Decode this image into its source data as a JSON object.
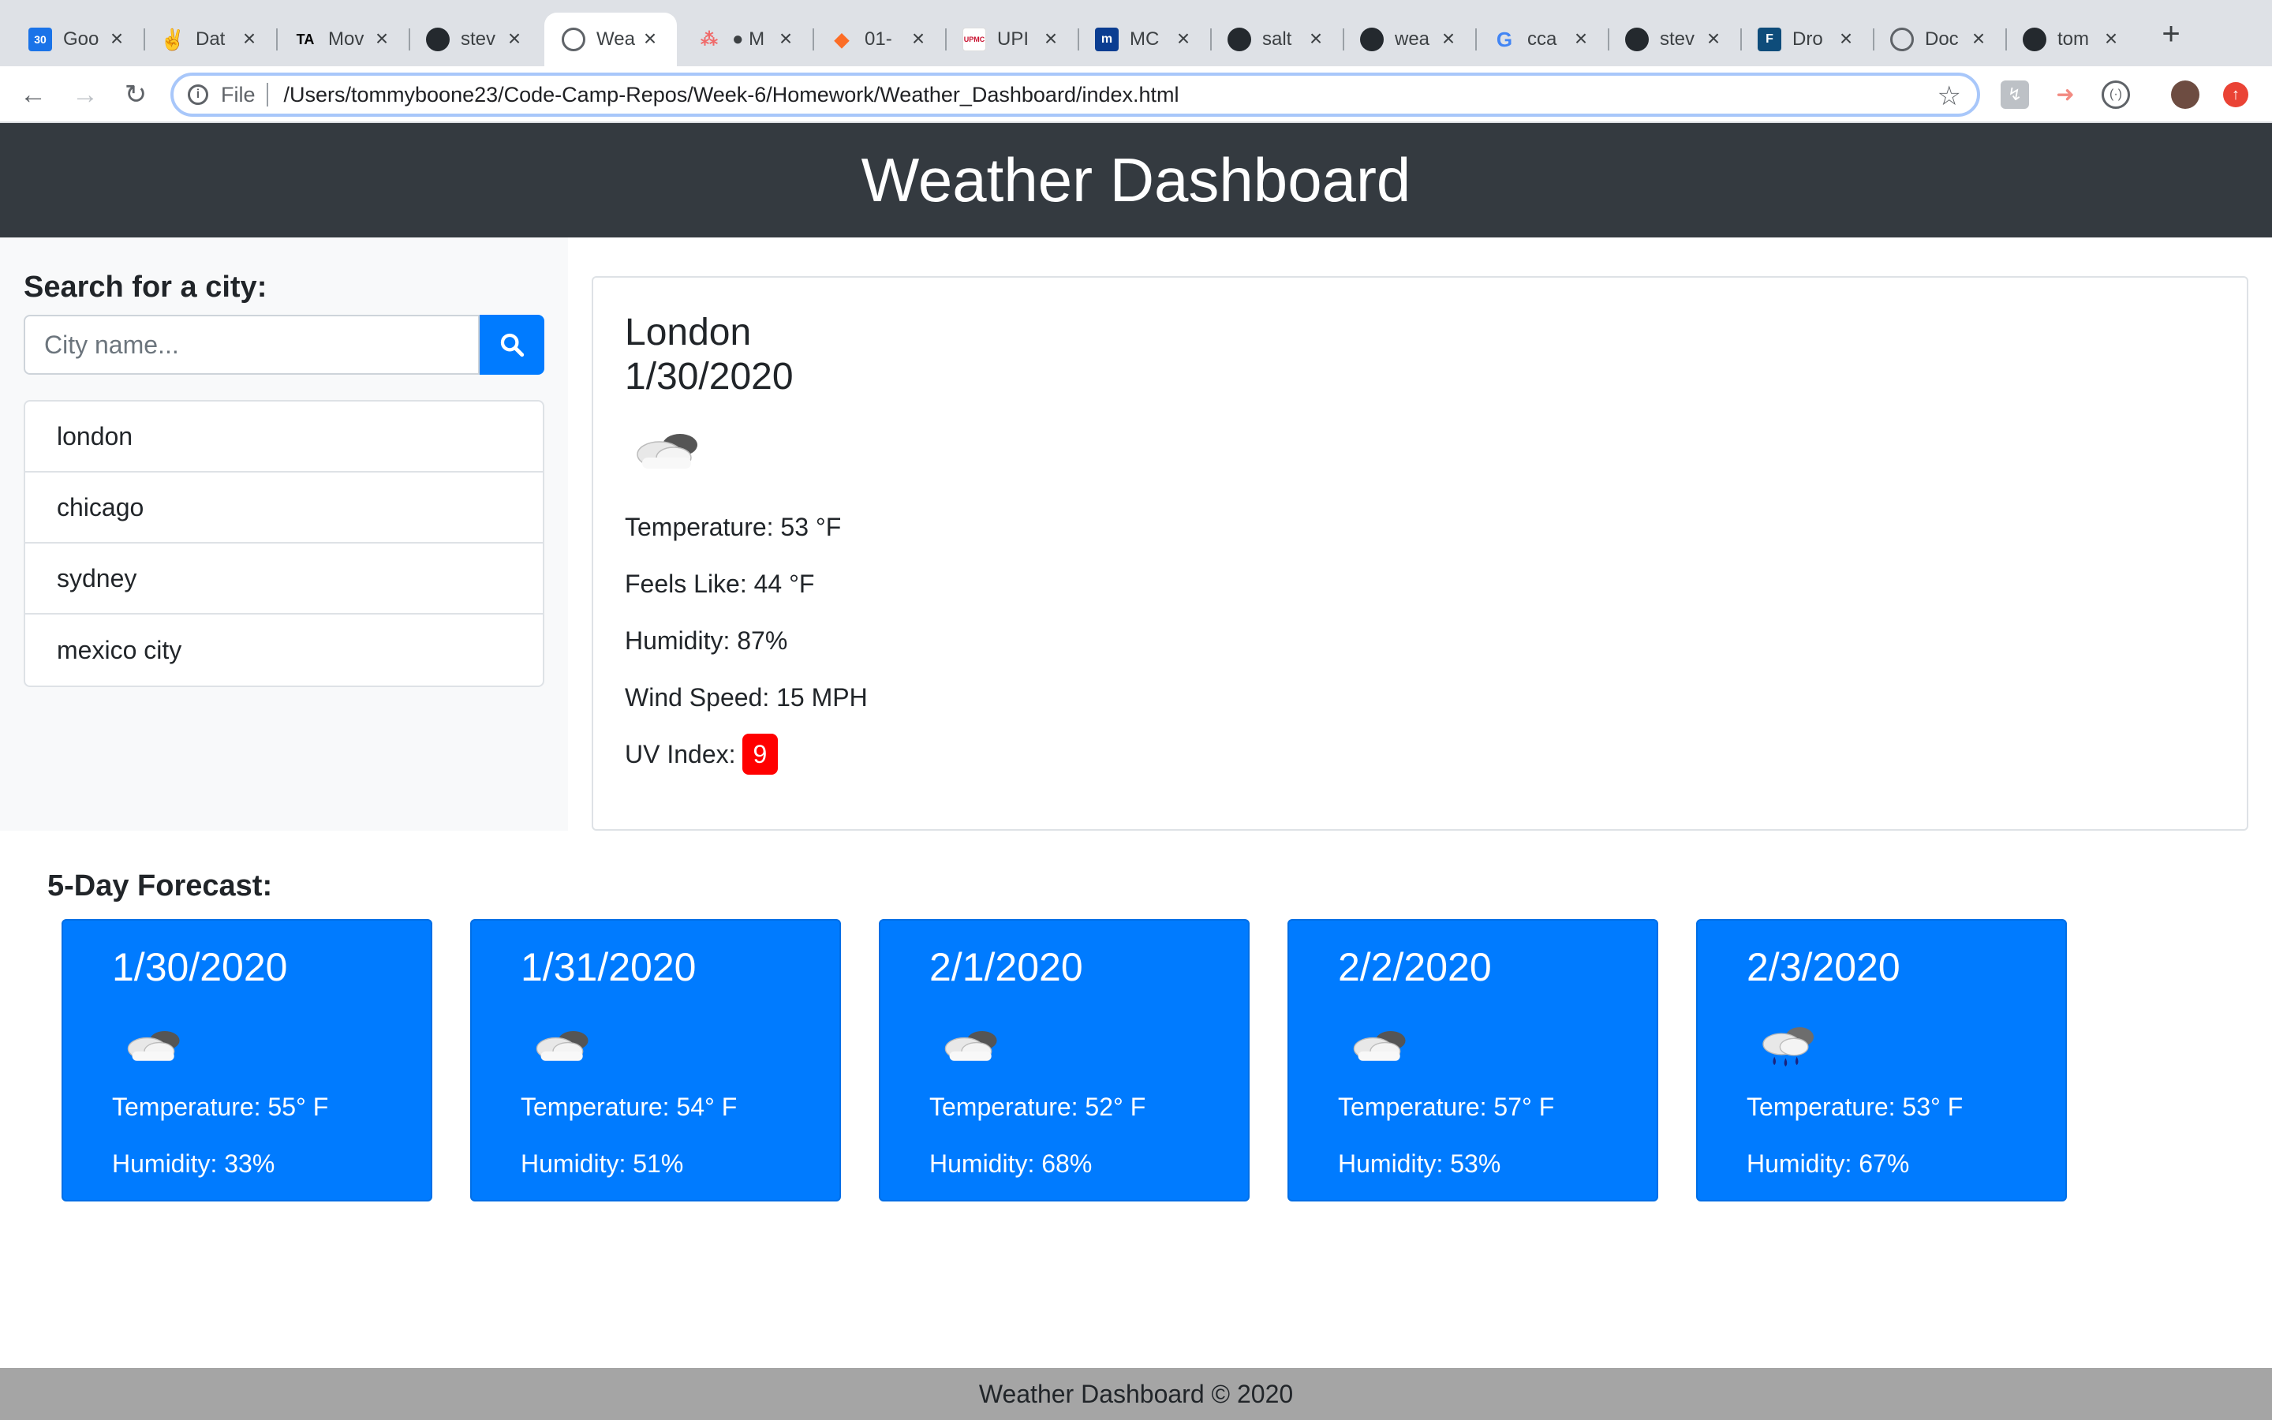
{
  "browser": {
    "tabs": [
      {
        "title": "Goo",
        "icon": "calendar-icon",
        "color": "#1a73e8"
      },
      {
        "title": "Dat",
        "icon": "peace-hand-icon",
        "color": "#5f6368"
      },
      {
        "title": "Mov",
        "icon": "ta-logo-icon",
        "color": "#000000"
      },
      {
        "title": "stev",
        "icon": "github-icon",
        "color": "#24292e"
      },
      {
        "title": "Wea",
        "icon": "globe-icon",
        "color": "#5f6368",
        "active": true
      },
      {
        "title": "● M",
        "icon": "asana-icon",
        "color": "#f06a6a"
      },
      {
        "title": "01-",
        "icon": "gitlab-icon",
        "color": "#fc6d26"
      },
      {
        "title": "UPI",
        "icon": "upmc-icon",
        "color": "#c8102e"
      },
      {
        "title": "MC",
        "icon": "m-logo-icon",
        "color": "#0b3d91"
      },
      {
        "title": "salt",
        "icon": "github-icon",
        "color": "#24292e"
      },
      {
        "title": "wea",
        "icon": "github-icon",
        "color": "#24292e"
      },
      {
        "title": "cca",
        "icon": "google-icon",
        "color": "#4285f4"
      },
      {
        "title": "stev",
        "icon": "github-icon",
        "color": "#24292e"
      },
      {
        "title": "Dro",
        "icon": "f-logo-icon",
        "color": "#0e4c7a"
      },
      {
        "title": "Doc",
        "icon": "globe-icon",
        "color": "#5f6368"
      },
      {
        "title": "tom",
        "icon": "github-icon",
        "color": "#24292e"
      }
    ],
    "scheme": "File",
    "url": "/Users/tommyboone23/Code-Camp-Repos/Week-6/Homework/Weather_Dashboard/index.html"
  },
  "header": {
    "title": "Weather Dashboard"
  },
  "search": {
    "label": "Search for a city:",
    "placeholder": "City name...",
    "history": [
      "london",
      "chicago",
      "sydney",
      "mexico city"
    ]
  },
  "current": {
    "city": "London",
    "date": "1/30/2020",
    "icon": "cloudy-icon",
    "temperature": "Temperature: 53 °F",
    "feels_like": "Feels Like: 44 °F",
    "humidity": "Humidity: 87%",
    "wind": "Wind Speed: 15 MPH",
    "uv_label": "UV Index:",
    "uv_value": "9",
    "uv_color": "#ff0000"
  },
  "forecast": {
    "title": "5-Day Forecast:",
    "days": [
      {
        "date": "1/30/2020",
        "icon": "cloudy-icon",
        "temp": "Temperature: 55° F",
        "humidity": "Humidity: 33%"
      },
      {
        "date": "1/31/2020",
        "icon": "cloudy-icon",
        "temp": "Temperature: 54° F",
        "humidity": "Humidity: 51%"
      },
      {
        "date": "2/1/2020",
        "icon": "cloudy-icon",
        "temp": "Temperature: 52° F",
        "humidity": "Humidity: 68%"
      },
      {
        "date": "2/2/2020",
        "icon": "cloudy-icon",
        "temp": "Temperature: 57° F",
        "humidity": "Humidity: 53%"
      },
      {
        "date": "2/3/2020",
        "icon": "rain-cloud-icon",
        "temp": "Temperature: 53° F",
        "humidity": "Humidity: 67%"
      }
    ]
  },
  "footer": {
    "text": "Weather Dashboard © 2020"
  },
  "colors": {
    "accent": "#007bff",
    "header_bg": "#343a40",
    "footer_bg": "#a5a5a5"
  }
}
